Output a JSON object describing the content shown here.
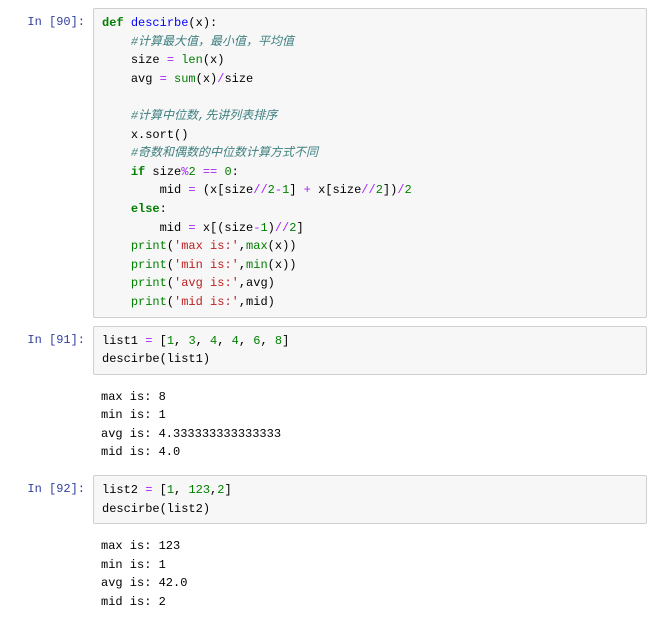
{
  "cells": [
    {
      "prompt": "In [90]:",
      "code_tokens": [
        [
          [
            "def",
            "kw"
          ],
          [
            " ",
            ""
          ],
          [
            "descirbe",
            "fn"
          ],
          [
            "(",
            ""
          ],
          [
            "x",
            ""
          ],
          [
            "):",
            ""
          ]
        ],
        [
          [
            "    ",
            ""
          ],
          [
            "#计算最大值，最小值，平均值",
            "cm"
          ]
        ],
        [
          [
            "    ",
            ""
          ],
          [
            "size ",
            ""
          ],
          [
            "= ",
            "op"
          ],
          [
            "len",
            "bi"
          ],
          [
            "(",
            ""
          ],
          [
            "x",
            ""
          ],
          [
            ")",
            ""
          ]
        ],
        [
          [
            "    ",
            ""
          ],
          [
            "avg ",
            ""
          ],
          [
            "= ",
            "op"
          ],
          [
            "sum",
            "bi"
          ],
          [
            "(",
            ""
          ],
          [
            "x",
            ""
          ],
          [
            ")",
            ""
          ],
          [
            "/",
            "op"
          ],
          [
            "size",
            ""
          ]
        ],
        [
          [
            "",
            ""
          ]
        ],
        [
          [
            "    ",
            ""
          ],
          [
            "#计算中位数,先讲列表排序",
            "cm"
          ]
        ],
        [
          [
            "    ",
            ""
          ],
          [
            "x",
            ""
          ],
          [
            ".",
            ""
          ],
          [
            "sort",
            ""
          ],
          [
            "()",
            ""
          ]
        ],
        [
          [
            "    ",
            ""
          ],
          [
            "#奇数和偶数的中位数计算方式不同",
            "cm"
          ]
        ],
        [
          [
            "    ",
            ""
          ],
          [
            "if",
            "kw"
          ],
          [
            " size",
            ""
          ],
          [
            "%",
            "op"
          ],
          [
            "2",
            "nm"
          ],
          [
            " ",
            ""
          ],
          [
            "==",
            "op"
          ],
          [
            " ",
            ""
          ],
          [
            "0",
            "nm"
          ],
          [
            ":",
            ""
          ]
        ],
        [
          [
            "        ",
            ""
          ],
          [
            "mid ",
            ""
          ],
          [
            "= ",
            "op"
          ],
          [
            "(x[size",
            ""
          ],
          [
            "//",
            "op"
          ],
          [
            "2",
            "nm"
          ],
          [
            "-",
            "op"
          ],
          [
            "1",
            "nm"
          ],
          [
            "] ",
            ""
          ],
          [
            "+",
            "op"
          ],
          [
            " x[size",
            ""
          ],
          [
            "//",
            "op"
          ],
          [
            "2",
            "nm"
          ],
          [
            "])",
            ""
          ],
          [
            "/",
            "op"
          ],
          [
            "2",
            "nm"
          ]
        ],
        [
          [
            "    ",
            ""
          ],
          [
            "else",
            "kw"
          ],
          [
            ":",
            ""
          ]
        ],
        [
          [
            "        ",
            ""
          ],
          [
            "mid ",
            ""
          ],
          [
            "= ",
            "op"
          ],
          [
            "x[(size",
            ""
          ],
          [
            "-",
            "op"
          ],
          [
            "1",
            "nm"
          ],
          [
            ")",
            ""
          ],
          [
            "//",
            "op"
          ],
          [
            "2",
            "nm"
          ],
          [
            "]",
            ""
          ]
        ],
        [
          [
            "    ",
            ""
          ],
          [
            "print",
            "bi"
          ],
          [
            "(",
            ""
          ],
          [
            "'max is:'",
            "st"
          ],
          [
            ",",
            ""
          ],
          [
            "max",
            "bi"
          ],
          [
            "(",
            ""
          ],
          [
            "x",
            ""
          ],
          [
            "))",
            ""
          ]
        ],
        [
          [
            "    ",
            ""
          ],
          [
            "print",
            "bi"
          ],
          [
            "(",
            ""
          ],
          [
            "'min is:'",
            "st"
          ],
          [
            ",",
            ""
          ],
          [
            "min",
            "bi"
          ],
          [
            "(",
            ""
          ],
          [
            "x",
            ""
          ],
          [
            "))",
            ""
          ]
        ],
        [
          [
            "    ",
            ""
          ],
          [
            "print",
            "bi"
          ],
          [
            "(",
            ""
          ],
          [
            "'avg is:'",
            "st"
          ],
          [
            ",avg)",
            ""
          ]
        ],
        [
          [
            "    ",
            ""
          ],
          [
            "print",
            "bi"
          ],
          [
            "(",
            ""
          ],
          [
            "'mid is:'",
            "st"
          ],
          [
            ",mid)",
            ""
          ]
        ]
      ],
      "output": null
    },
    {
      "prompt": "In [91]:",
      "code_tokens": [
        [
          [
            "list1 ",
            ""
          ],
          [
            "= ",
            "op"
          ],
          [
            "[",
            ""
          ],
          [
            "1",
            "nm"
          ],
          [
            ", ",
            ""
          ],
          [
            "3",
            "nm"
          ],
          [
            ", ",
            ""
          ],
          [
            "4",
            "nm"
          ],
          [
            ", ",
            ""
          ],
          [
            "4",
            "nm"
          ],
          [
            ", ",
            ""
          ],
          [
            "6",
            "nm"
          ],
          [
            ", ",
            ""
          ],
          [
            "8",
            "nm"
          ],
          [
            "]",
            ""
          ]
        ],
        [
          [
            "descirbe(list1)",
            ""
          ]
        ]
      ],
      "output": "max is: 8\nmin is: 1\navg is: 4.333333333333333\nmid is: 4.0"
    },
    {
      "prompt": "In [92]:",
      "code_tokens": [
        [
          [
            "list2 ",
            ""
          ],
          [
            "= ",
            "op"
          ],
          [
            "[",
            ""
          ],
          [
            "1",
            "nm"
          ],
          [
            ", ",
            ""
          ],
          [
            "123",
            "nm"
          ],
          [
            ",",
            ""
          ],
          [
            "2",
            "nm"
          ],
          [
            "]",
            ""
          ]
        ],
        [
          [
            "descirbe(list2)",
            ""
          ]
        ]
      ],
      "output": "max is: 123\nmin is: 1\navg is: 42.0\nmid is: 2"
    }
  ]
}
